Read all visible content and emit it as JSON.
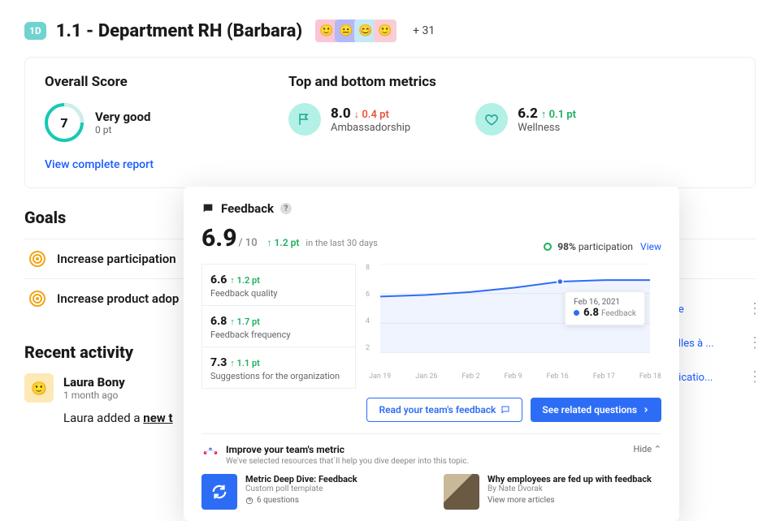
{
  "header": {
    "badge": "1D",
    "title": "1.1 - Department RH (Barbara)",
    "extra_count": "+ 31"
  },
  "overview": {
    "overall_title": "Overall Score",
    "overall_value": "7",
    "overall_label": "Very good",
    "overall_delta": "0 pt",
    "metrics_title": "Top and bottom metrics",
    "metric1": {
      "value": "8.0",
      "delta": "0.4 pt",
      "name": "Ambassadorship"
    },
    "metric2": {
      "value": "6.2",
      "delta": "0.1 pt",
      "name": "Wellness"
    },
    "report_link": "View complete report"
  },
  "goals": {
    "title": "Goals",
    "items": [
      "Increase participation",
      "Increase product adop"
    ]
  },
  "activity": {
    "title": "Recent activity",
    "user": "Laura Bony",
    "time": "1 month ago",
    "body_prefix": "Laura added a ",
    "body_link": "new t"
  },
  "peek": {
    "items": [
      "ee",
      "elles à ...",
      "nicatio..."
    ]
  },
  "feedback": {
    "title": "Feedback",
    "score": "6.9",
    "out_of": "/ 10",
    "change": "1.2 pt",
    "period": "in the last 30 days",
    "participation_pct": "98%",
    "participation_label": "participation",
    "view_link": "View",
    "subs": [
      {
        "value": "6.6",
        "delta": "1.2 pt",
        "name": "Feedback quality"
      },
      {
        "value": "6.8",
        "delta": "1.7 pt",
        "name": "Feedback frequency"
      },
      {
        "value": "7.3",
        "delta": "1.1 pt",
        "name": "Suggestions for the organization"
      }
    ],
    "tooltip": {
      "date": "Feb 16, 2021",
      "value": "6.8",
      "label": "Feedback"
    },
    "btn_outline": "Read your team's feedback",
    "btn_primary": "See related questions",
    "improve": {
      "title": "Improve your team's metric",
      "subtitle": "We've selected resources that`ll help you dive deeper into this topic.",
      "hide": "Hide"
    },
    "resources": [
      {
        "title": "Metric Deep Dive: Feedback",
        "sub": "Custom poll template",
        "meta": "6 questions"
      },
      {
        "title": "Why employees are fed up with feedback",
        "sub": "By Nate Dvorak",
        "meta": "View more articles"
      }
    ]
  },
  "chart_data": {
    "type": "line",
    "title": "Feedback",
    "ylabel": "",
    "xlabel": "",
    "ylim": [
      2,
      8
    ],
    "yticks": [
      2.0,
      4.0,
      6.0,
      8.0
    ],
    "x": [
      "Jan 19",
      "Jan 26",
      "Feb 2",
      "Feb 9",
      "Feb 16",
      "Feb 17",
      "Feb 18"
    ],
    "series": [
      {
        "name": "Feedback",
        "values": [
          5.8,
          5.9,
          6.1,
          6.4,
          6.8,
          6.9,
          6.9
        ]
      }
    ]
  }
}
